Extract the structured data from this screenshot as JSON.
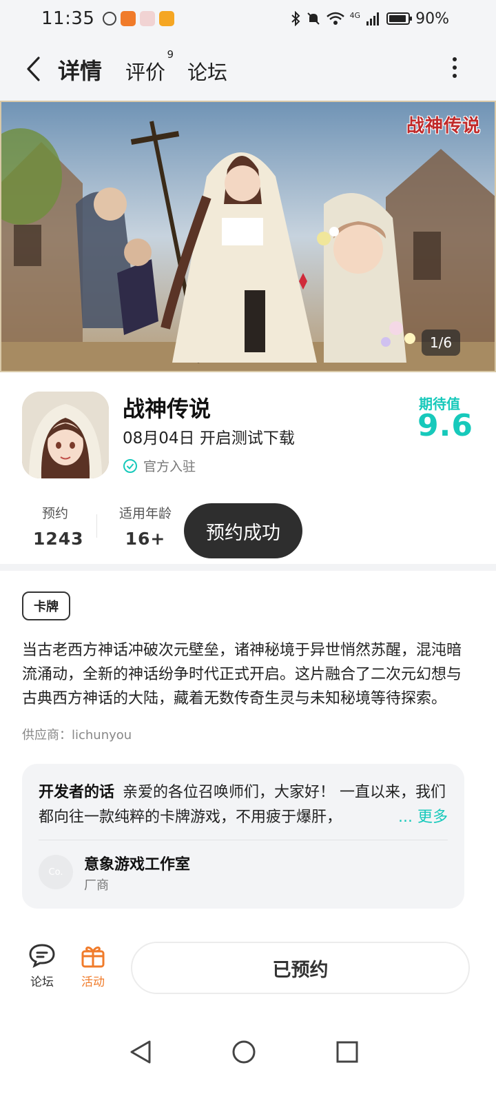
{
  "status_bar": {
    "time": "11:35",
    "network": "4G",
    "battery": "90%"
  },
  "header": {
    "tabs": [
      {
        "label": "详情",
        "active": true
      },
      {
        "label": "评价",
        "badge": "9"
      },
      {
        "label": "论坛"
      }
    ]
  },
  "banner": {
    "logo_text": "战神传说",
    "counter": "1/6"
  },
  "game": {
    "title": "战神传说",
    "release_text": "08月04日 开启测试下载",
    "official_label": "官方入驻",
    "expect_label": "期待值",
    "expect_value": "9.6"
  },
  "stats": {
    "reserve_label": "预约",
    "reserve_value": "1243",
    "age_label": "适用年龄",
    "age_value": "16+",
    "reserve_button": "预约成功"
  },
  "tag": "卡牌",
  "description": "当古老西方神话冲破次元壁垒，诸神秘境于异世悄然苏醒，混沌暗流涌动，全新的神话纷争时代正式开启。这片融合了二次元幻想与古典西方神话的大陆，藏着无数传奇生灵与未知秘境等待探索。",
  "supplier": "供应商：lichunyou",
  "developer": {
    "label": "开发者的话",
    "words": "亲爱的各位召唤师们，大家好！ 一直以来，我们都向往一款纯粹的卡牌游戏，不用疲于爆肝，",
    "ellipsis": "...",
    "more": "更多",
    "avatar_text": "Co.",
    "name": "意象游戏工作室",
    "role": "厂商"
  },
  "bottom_bar": {
    "forum_label": "论坛",
    "activity_label": "活动",
    "reserved_button": "已预约"
  },
  "colors": {
    "accent": "#17c9bb",
    "activity": "#f07b2a",
    "dark_button": "#2e2e2e"
  }
}
